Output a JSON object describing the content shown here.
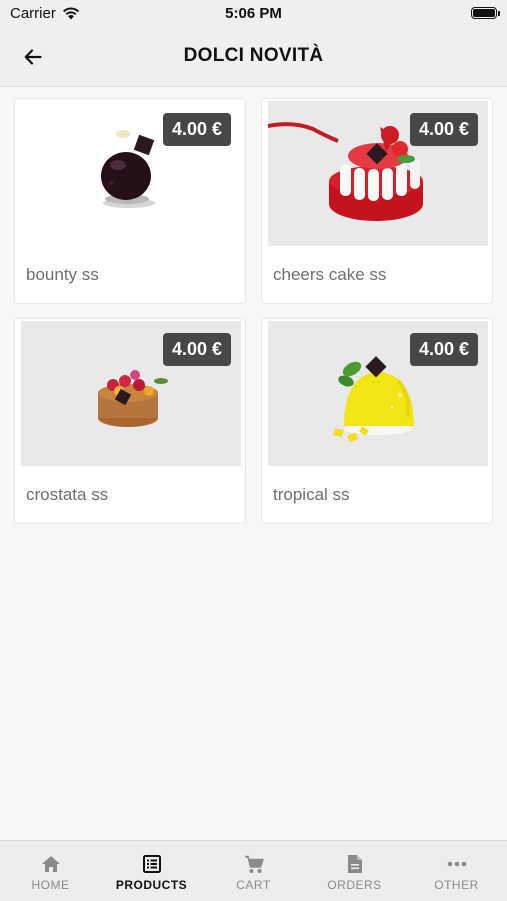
{
  "status_bar": {
    "carrier": "Carrier",
    "time": "5:06 PM"
  },
  "header": {
    "title": "DOLCI NOVITÀ",
    "back_icon": "arrow-left-icon"
  },
  "products": [
    {
      "name": "bounty ss",
      "price": "4.00 €"
    },
    {
      "name": "cheers cake ss",
      "price": "4.00 €"
    },
    {
      "name": "crostata ss",
      "price": "4.00 €"
    },
    {
      "name": "tropical ss",
      "price": "4.00 €"
    }
  ],
  "tabs": [
    {
      "label": "HOME",
      "icon": "home-icon"
    },
    {
      "label": "PRODUCTS",
      "icon": "list-icon",
      "active": true
    },
    {
      "label": "CART",
      "icon": "cart-icon"
    },
    {
      "label": "ORDERS",
      "icon": "document-icon"
    },
    {
      "label": "OTHER",
      "icon": "more-icon"
    }
  ],
  "colors": {
    "price_badge": "#474747",
    "tab_active": "#111111",
    "tab_inactive": "#8a8a8a"
  }
}
